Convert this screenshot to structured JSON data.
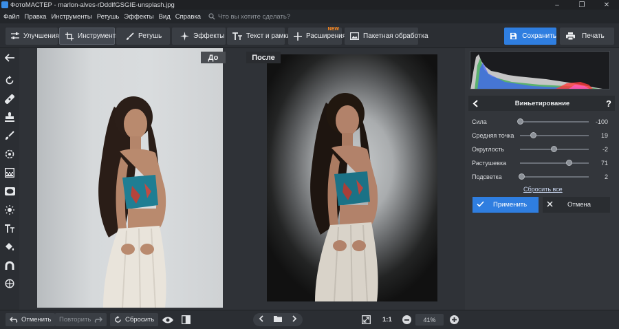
{
  "window": {
    "title": "ФотоМАСТЕР - marlon-alves-rDddlfGSGIE-unsplash.jpg"
  },
  "menu": {
    "items": [
      "Файл",
      "Правка",
      "Инструменты",
      "Ретушь",
      "Эффекты",
      "Вид",
      "Справка"
    ],
    "search_placeholder": "Что вы хотите сделать?"
  },
  "toolbar": {
    "tabs": [
      {
        "label": "Улучшения",
        "icon": "sliders-icon"
      },
      {
        "label": "Инструменты",
        "icon": "crop-icon",
        "active": true
      },
      {
        "label": "Ретушь",
        "icon": "brush-icon"
      },
      {
        "label": "Эффекты",
        "icon": "sparkle-icon"
      },
      {
        "label": "Текст и рамки",
        "icon": "text-icon"
      },
      {
        "label": "Расширения",
        "icon": "plus-icon",
        "badge": "NEW"
      },
      {
        "label": "Пакетная обработка",
        "icon": "images-icon"
      }
    ],
    "save_label": "Сохранить",
    "print_label": "Печать"
  },
  "left_tools": [
    "back-arrow-icon",
    "rotate-icon",
    "bandage-icon",
    "stamp-icon",
    "brush-icon",
    "target-icon",
    "gradient-icon",
    "vignette-icon",
    "sun-icon",
    "text-icon",
    "bucket-icon",
    "magnet-icon",
    "globe-icon"
  ],
  "canvas": {
    "before_label": "До",
    "after_label": "После"
  },
  "panel": {
    "title": "Виньетирование",
    "help": "?",
    "sliders": [
      {
        "label": "Сила",
        "value": "-100",
        "position": 0.0
      },
      {
        "label": "Средняя точка",
        "value": "19",
        "position": 0.19
      },
      {
        "label": "Округлость",
        "value": "-2",
        "position": 0.49
      },
      {
        "label": "Растушевка",
        "value": "71",
        "position": 0.71
      },
      {
        "label": "Подсветка",
        "value": "2",
        "position": 0.02
      }
    ],
    "reset_label": "Сбросить все",
    "apply_label": "Применить",
    "cancel_label": "Отмена"
  },
  "bottom": {
    "undo_label": "Отменить",
    "redo_label": "Повторить",
    "reset_label": "Сбросить",
    "ratio_label": "1:1",
    "zoom": "41%"
  },
  "colors": {
    "accent": "#2f7ee0",
    "new_badge": "#ff8a1f"
  }
}
